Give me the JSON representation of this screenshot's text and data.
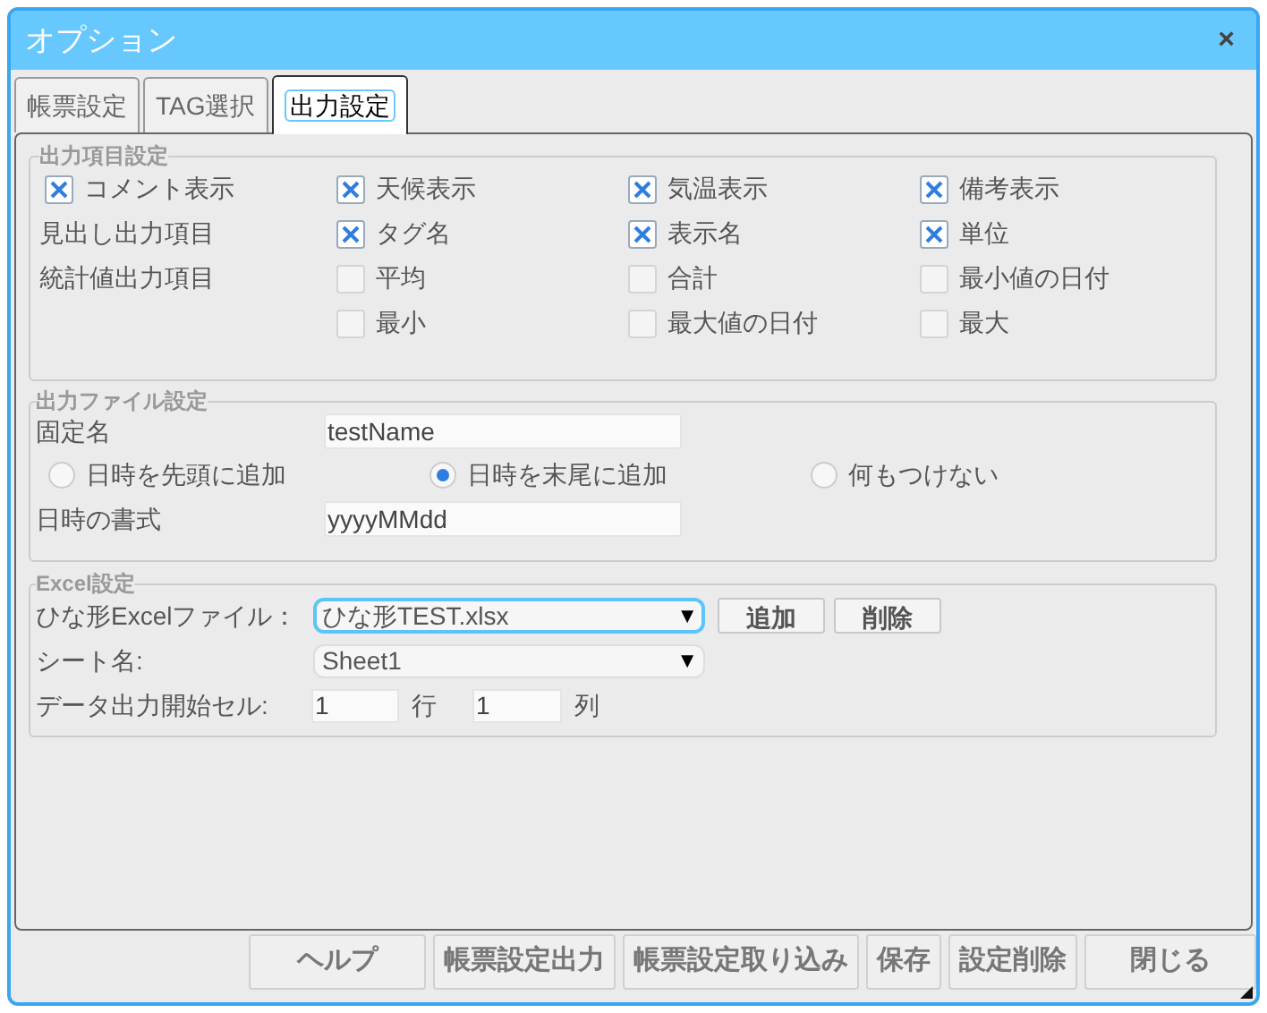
{
  "window": {
    "title": "オプション",
    "close": "×"
  },
  "tabs": [
    {
      "label": "帳票設定",
      "selected": false
    },
    {
      "label": "TAG選択",
      "selected": false
    },
    {
      "label": "出力設定",
      "selected": true
    }
  ],
  "output_items": {
    "legend": "出力項目設定",
    "rows": [
      [
        {
          "kind": "checkbox",
          "text": "コメント表示",
          "checked": true
        },
        {
          "kind": "checkbox",
          "text": "天候表示",
          "checked": true
        },
        {
          "kind": "checkbox",
          "text": "気温表示",
          "checked": true
        },
        {
          "kind": "checkbox",
          "text": "備考表示",
          "checked": true
        }
      ],
      [
        {
          "kind": "label",
          "text": "見出し出力項目"
        },
        {
          "kind": "checkbox",
          "text": "タグ名",
          "checked": true
        },
        {
          "kind": "checkbox",
          "text": "表示名",
          "checked": true
        },
        {
          "kind": "checkbox",
          "text": "単位",
          "checked": true
        }
      ],
      [
        {
          "kind": "label",
          "text": "統計値出力項目"
        },
        {
          "kind": "checkbox",
          "text": "平均",
          "checked": false
        },
        {
          "kind": "checkbox",
          "text": "合計",
          "checked": false
        },
        {
          "kind": "checkbox",
          "text": "最小値の日付",
          "checked": false
        }
      ],
      [
        {
          "kind": "empty"
        },
        {
          "kind": "checkbox",
          "text": "最小",
          "checked": false
        },
        {
          "kind": "checkbox",
          "text": "最大値の日付",
          "checked": false
        },
        {
          "kind": "checkbox",
          "text": "最大",
          "checked": false
        }
      ]
    ]
  },
  "output_file": {
    "legend": "出力ファイル設定",
    "fixed_name_label": "固定名",
    "fixed_name": "testName",
    "radios": [
      {
        "label": "日時を先頭に追加",
        "selected": false
      },
      {
        "label": "日時を末尾に追加",
        "selected": true
      },
      {
        "label": "何もつけない",
        "selected": false
      }
    ],
    "date_format_label": "日時の書式",
    "date_format": "yyyyMMdd"
  },
  "excel": {
    "legend": "Excel設定",
    "template_label": "ひな形Excelファイル：",
    "template": "ひな形TEST.xlsx",
    "dropdown_arrow": "▼",
    "add": "追加",
    "delete": "削除",
    "sheet_label": "シート名:",
    "sheet": "Sheet1",
    "sheet_arrow": "▼",
    "start_cell_label": "データ出力開始セル:",
    "row_value": "1",
    "row_unit": "行",
    "col_value": "1",
    "col_unit": "列"
  },
  "buttons": [
    "ヘルプ",
    "帳票設定出力",
    "帳票設定取り込み",
    "保存",
    "設定削除",
    "閉じる"
  ]
}
